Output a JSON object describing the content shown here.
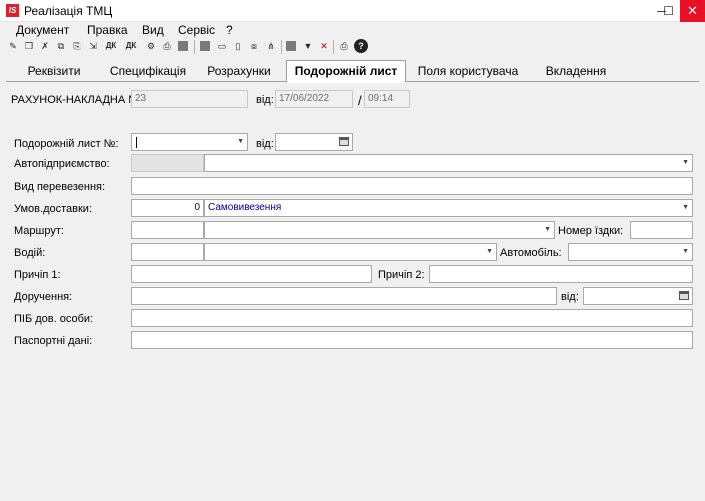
{
  "window": {
    "logo": "IS",
    "title": "Реалізація ТМЦ",
    "minimize": "─",
    "maximize": "☐",
    "close": "✕"
  },
  "menu": [
    "Документ",
    "Правка",
    "Вид",
    "Сервіс",
    "?"
  ],
  "toolbar": {
    "icons": [
      "new-doc-icon",
      "copy-doc-icon",
      "delete-doc-icon",
      "duplicate-icon",
      "paste-icon",
      "nav-icon",
      "debit-credit-icon",
      "debit-credit-alt-icon",
      "settings-icon",
      "print-preview-icon",
      "report-icon",
      "grid-icon",
      "columns-icon",
      "split-icon",
      "link-icon",
      "tree-icon",
      "sort-icon",
      "filter-icon",
      "clear-filter-icon",
      "print-icon",
      "help-icon"
    ],
    "dk_label": "ДК"
  },
  "tabs": [
    {
      "label": "Реквізити",
      "active": false
    },
    {
      "label": "Специфікація",
      "active": false
    },
    {
      "label": "Розрахунки",
      "active": false
    },
    {
      "label": "Подорожній лист",
      "active": true
    },
    {
      "label": "Поля користувача",
      "active": false
    },
    {
      "label": "Вкладення",
      "active": false
    }
  ],
  "header": {
    "invoice_label": "РАХУНОК-НАКЛАДНА №:",
    "invoice_number": "23",
    "date_label": "від:",
    "date": "17/06/2022",
    "separator": "/",
    "time": "09:14"
  },
  "form": {
    "waybill_label": "Подорожній лист №:",
    "waybill_value": "",
    "waybill_date_label": "від:",
    "waybill_date": "",
    "transport_company_label": "Автопідприємство:",
    "transport_type_label": "Вид перевезення:",
    "delivery_terms_label": "Умов.доставки:",
    "delivery_terms_code": "0",
    "delivery_terms_value": "Самовивезення",
    "route_label": "Маршрут:",
    "trip_number_label": "Номер їздки:",
    "driver_label": "Водій:",
    "vehicle_label": "Автомобіль:",
    "trailer1_label": "Причіп 1:",
    "trailer2_label": "Причіп 2:",
    "power_of_attorney_label": "Доручення:",
    "poa_date_label": "від:",
    "authorized_person_label": "ПІБ дов. особи:",
    "passport_label": "Паспортні дані:"
  }
}
